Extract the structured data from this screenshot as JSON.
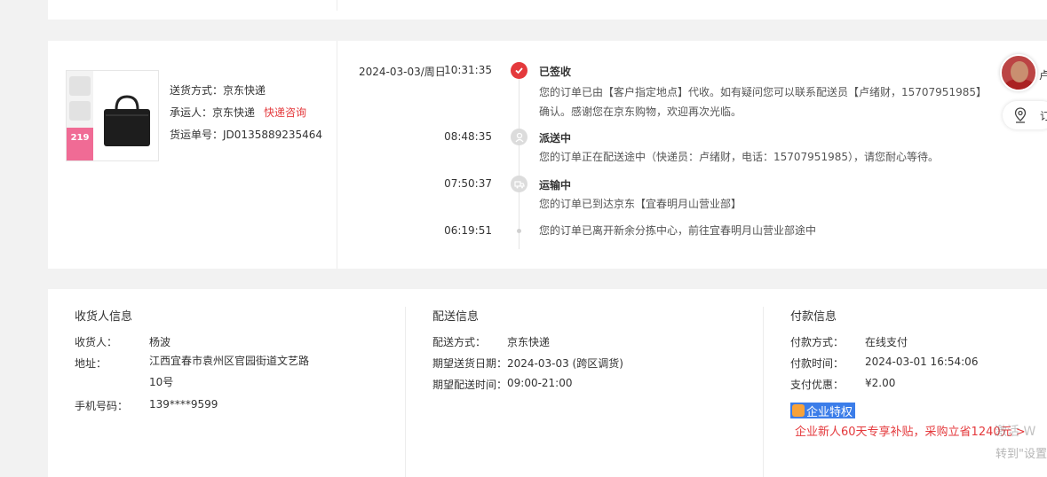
{
  "shipment": {
    "method_label": "送货方式：",
    "method_value": "京东快递",
    "carrier_label": "承运人：",
    "carrier_value": "京东快递",
    "consult_link": "快递咨询",
    "tracking_label": "货运单号：",
    "tracking_value": "JD0135889235464",
    "product_price_tag": "219"
  },
  "timeline": [
    {
      "date": "2024-03-03/周日",
      "time": "10:31:35",
      "title": "已签收",
      "icon": "check-icon",
      "status_color": "#e4393c",
      "desc": "您的订单已由【客户指定地点】代收。如有疑问您可以联系配送员【卢绪财，15707951985】确认。感谢您在京东购物，欢迎再次光临。"
    },
    {
      "date": "",
      "time": "08:48:35",
      "title": "派送中",
      "icon": "delivery-person-icon",
      "desc": "您的订单正在配送途中（快递员：卢绪财，电话：15707951985），请您耐心等待。"
    },
    {
      "date": "",
      "time": "07:50:37",
      "title": "运输中",
      "icon": "truck-icon",
      "desc": "您的订单已到达京东【宜春明月山营业部】"
    },
    {
      "date": "",
      "time": "06:19:51",
      "title": "",
      "icon": "dot",
      "desc": "您的订单已离开新余分拣中心，前往宜春明月山营业部途中"
    }
  ],
  "side": {
    "name_partial": "卢",
    "map_partial": "订"
  },
  "receiver": {
    "heading": "收货人信息",
    "name_label": "收货人：",
    "name_value": "杨波",
    "address_label": "地址：",
    "address_value": "江西宜春市袁州区官园街道文艺路10号",
    "phone_label": "手机号码：",
    "phone_value": "139****9599"
  },
  "delivery": {
    "heading": "配送信息",
    "method_label": "配送方式：",
    "method_value": "京东快递",
    "date_label": "期望送货日期：",
    "date_value": "2024-03-03 (跨区调货)",
    "time_label": "期望配送时间：",
    "time_value": "09:00-21:00"
  },
  "payment": {
    "heading": "付款信息",
    "method_label": "付款方式：",
    "method_value": "在线支付",
    "time_label": "付款时间：",
    "time_value": "2024-03-01 16:54:06",
    "discount_label": "支付优惠：",
    "discount_value": "¥2.00",
    "badge_label": "企业特权",
    "promo_text": "企业新人60天专享补贴，采购立省1240元 >",
    "watermark_1": "激活 W",
    "watermark_2": "转到\"设置"
  }
}
